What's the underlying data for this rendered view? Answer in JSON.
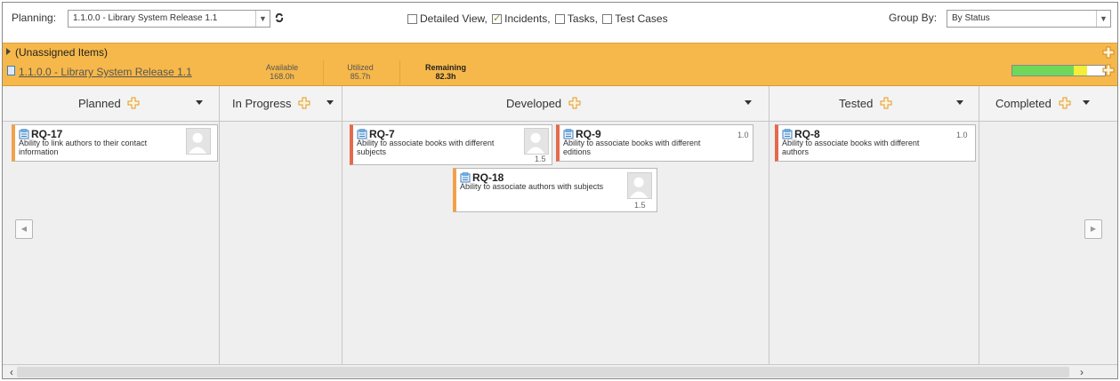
{
  "toolbar": {
    "planning_label": "Planning:",
    "planning_value": "1.1.0.0 - Library System Release 1.1",
    "options": [
      {
        "label": "Detailed View,",
        "checked": false
      },
      {
        "label": "Incidents,",
        "checked": true
      },
      {
        "label": "Tasks,",
        "checked": false
      },
      {
        "label": "Test Cases",
        "checked": false
      }
    ],
    "group_by_label": "Group By:",
    "group_by_value": "By Status"
  },
  "unassigned": {
    "label": "(Unassigned Items)"
  },
  "release": {
    "link": "1.1.0.0 - Library System Release 1.1",
    "available_label": "Available",
    "available_value": "168.0h",
    "utilized_label": "Utilized",
    "utilized_value": "85.7h",
    "remaining_label": "Remaining",
    "remaining_value": "82.3h",
    "progress_green_fraction": 0.66,
    "progress_yellow_fraction": 0.15
  },
  "columns": [
    {
      "title": "Planned"
    },
    {
      "title": "In Progress"
    },
    {
      "title": "Developed"
    },
    {
      "title": "Tested"
    },
    {
      "title": "Completed"
    }
  ],
  "cards": {
    "rq17": {
      "id": "RQ-17",
      "line1": "Ability to link authors to their contact",
      "line2": "information",
      "estimate": ""
    },
    "rq7": {
      "id": "RQ-7",
      "line1": "Ability to associate books with different",
      "line2": "subjects",
      "estimate": "1.5"
    },
    "rq9": {
      "id": "RQ-9",
      "line1": "Ability to associate books with different",
      "line2": "editions",
      "estimate": "1.0"
    },
    "rq18": {
      "id": "RQ-18",
      "line1": "Ability to associate authors with subjects",
      "line2": "",
      "estimate": "1.5"
    },
    "rq8": {
      "id": "RQ-8",
      "line1": "Ability to associate books with different",
      "line2": "authors",
      "estimate": "1.0"
    }
  },
  "colors": {
    "bar_orange": "#f6b84a",
    "card_edge_red": "#e46a4e",
    "plus_icon": "#f4a640"
  }
}
